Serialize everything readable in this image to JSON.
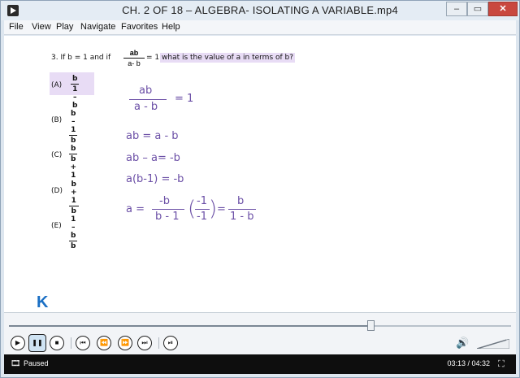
{
  "window": {
    "title": "CH. 2 OF 18 – ALGEBRA- ISOLATING A VARIABLE.mp4",
    "minimize_label": "–",
    "maximize_label": "▭",
    "close_label": "✕"
  },
  "menu": [
    "File",
    "View",
    "Play",
    "Navigate",
    "Favorites",
    "Help"
  ],
  "question": {
    "prefix": "3. If b = 1 and if",
    "frac_num": "ab",
    "frac_den": "a- b",
    "eq": "= 1.",
    "highlight": "what is the value of a in terms of b?"
  },
  "options": [
    {
      "label": "(A)",
      "num": "b",
      "den": "1 – b"
    },
    {
      "label": "(B)",
      "num": "b – 1",
      "den": "b"
    },
    {
      "label": "(C)",
      "num": "b",
      "den": "b + 1"
    },
    {
      "label": "(D)",
      "num": "b + 1",
      "den": "b"
    },
    {
      "label": "(E)",
      "num": "1 – b",
      "den": "b"
    }
  ],
  "handwriting": {
    "l1_num": "ab",
    "l1_den": "a - b",
    "l1_rhs": "= 1",
    "l2": "ab = a - b",
    "l3": "ab – a= -b",
    "l4": "a(b-1) = -b",
    "l5_lhs": "a =",
    "l5_f1_num": "-b",
    "l5_f1_den": "b - 1",
    "l5_f2_num": "-1",
    "l5_f2_den": "-1",
    "l5_eq": "=",
    "l5_f3_num": "b",
    "l5_f3_den": "1 - b"
  },
  "brand_glyph": "K",
  "controls": {
    "progress_fraction": 0.72,
    "volume_fraction": 0.9
  },
  "status": {
    "state": "Paused",
    "time": "03:13 / 04:32"
  },
  "colors": {
    "highlight": "#e8dcf5",
    "handwriting": "#6b4fa6",
    "brand": "#1a6fc4",
    "close_button": "#c9483f"
  }
}
